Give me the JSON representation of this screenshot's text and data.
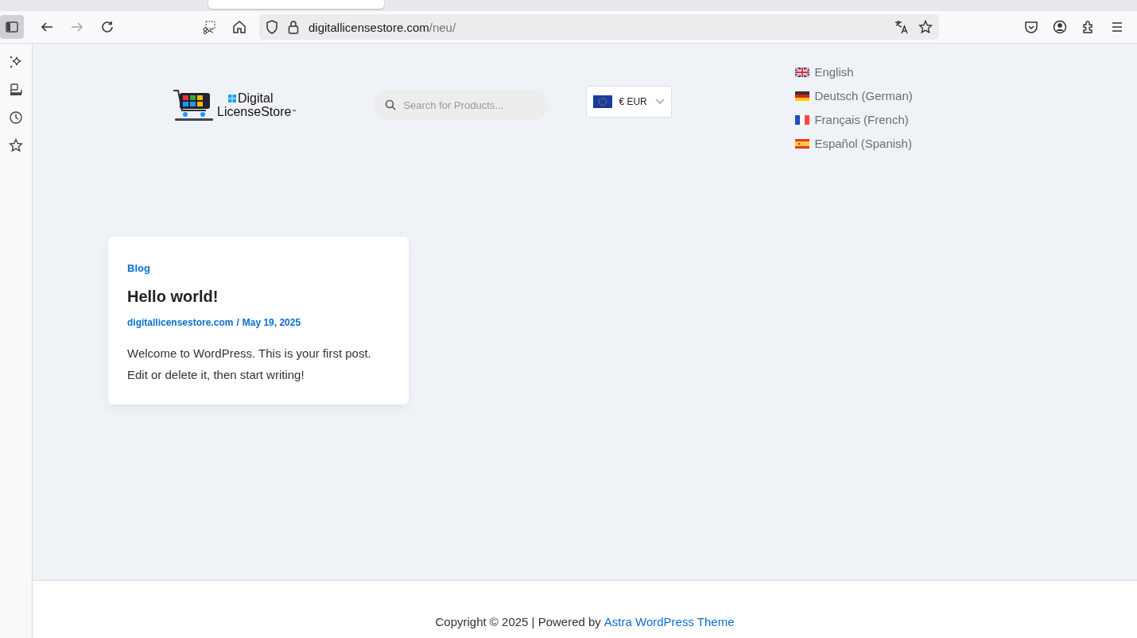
{
  "browser": {
    "url_host": "digitallicensestore.com",
    "url_path": "/neu/"
  },
  "header": {
    "logo_line_1": "Digital",
    "logo_line_2": "LicenseStore",
    "logo_mark": "™",
    "search": {
      "placeholder": "Search for Products..."
    },
    "currency": "€ EUR"
  },
  "languages": [
    {
      "label": "English",
      "kind": "uk"
    },
    {
      "label": "Deutsch (German)",
      "kind": "de"
    },
    {
      "label": "Français (French)",
      "kind": "fr"
    },
    {
      "label": "Español (Spanish)",
      "kind": "es"
    }
  ],
  "post": {
    "category": "Blog",
    "title": "Hello world!",
    "author": "digitallicensestore.com",
    "separator": "/",
    "date": "May 19, 2025",
    "excerpt": "Welcome to WordPress. This is your first post. Edit or delete it, then start writing!"
  },
  "footer": {
    "text": "Copyright © 2025 | Powered by",
    "link": "Astra WordPress Theme"
  }
}
